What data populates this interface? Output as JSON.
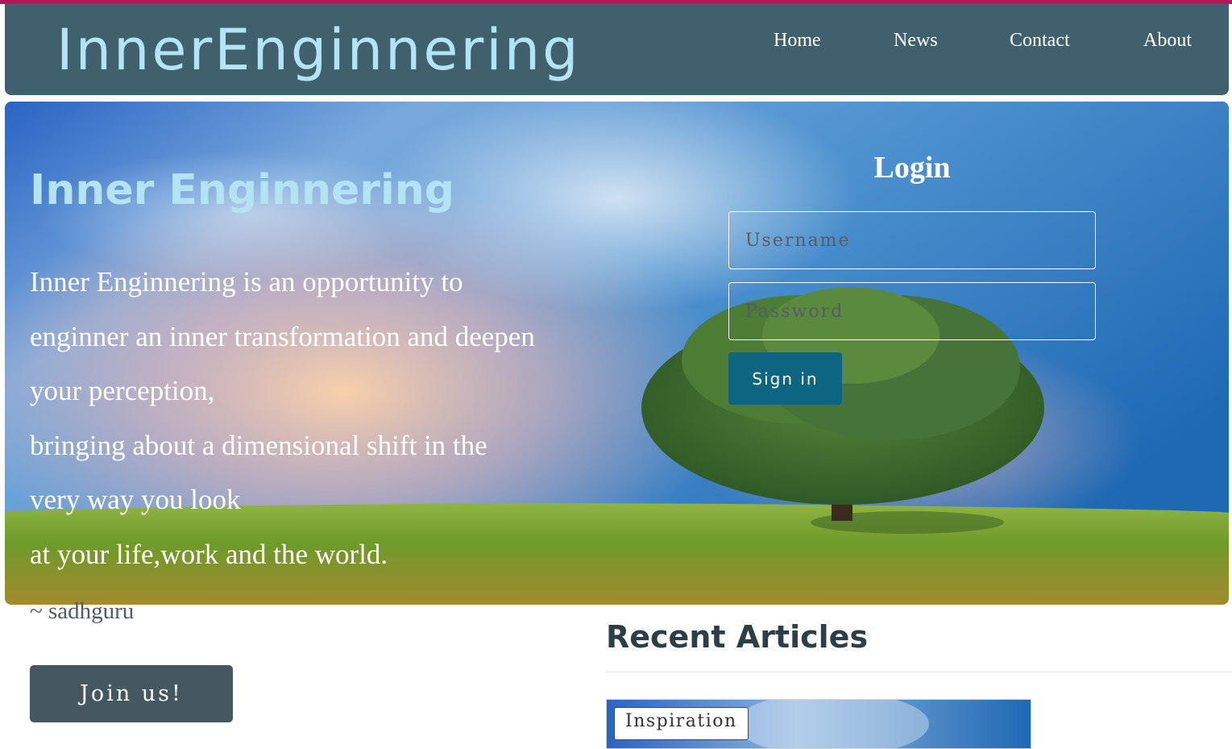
{
  "header": {
    "brand": "InnerEnginnering",
    "nav": [
      "Home",
      "News",
      "Contact",
      "About"
    ]
  },
  "hero": {
    "title": "Inner Enginnering",
    "lines": [
      "Inner Enginnering is an opportunity to",
      "enginner an inner transformation and deepen",
      "your perception,",
      "bringing about a dimensional shift in the",
      "very way you look",
      "at your life,work and the world."
    ],
    "attribution": "~ sadhguru"
  },
  "login": {
    "title": "Login",
    "username_placeholder": "Username",
    "password_placeholder": "Password",
    "submit_label": "Sign in"
  },
  "cta": {
    "join_label": "Join us!"
  },
  "articles": {
    "heading": "Recent Articles",
    "items": [
      {
        "tag": "Inspiration"
      }
    ]
  },
  "colors": {
    "accent_line": "#b3195a",
    "header_bg": "#41606e",
    "brand_text": "#b4e3f4",
    "signin_bg": "#0e6582",
    "join_bg": "#46585f"
  }
}
